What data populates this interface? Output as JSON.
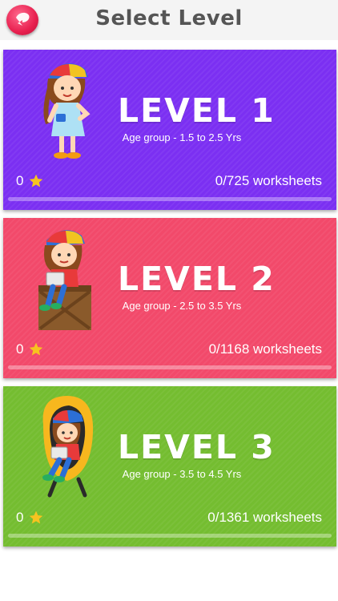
{
  "header": {
    "title": "Select Level",
    "back_icon": "back-icon",
    "back_color": "#e8204f"
  },
  "levels": [
    {
      "title": "LEVEL 1",
      "age_group": "Age group - 1.5 to 2.5 Yrs",
      "stars": "0",
      "worksheets": "0/725 worksheets",
      "progress": 0,
      "color": "#7b2ff2",
      "illustration": "girl-standing-illustration"
    },
    {
      "title": "LEVEL 2",
      "age_group": "Age group - 2.5 to 3.5 Yrs",
      "stars": "0",
      "worksheets": "0/1168 worksheets",
      "progress": 0,
      "color": "#f2496a",
      "illustration": "girl-on-crate-illustration"
    },
    {
      "title": "LEVEL 3",
      "age_group": "Age group - 3.5 to 4.5 Yrs",
      "stars": "0",
      "worksheets": "0/1361 worksheets",
      "progress": 0,
      "color": "#74bd30",
      "illustration": "girl-in-chair-illustration"
    }
  ],
  "star_icon": "star-icon",
  "star_color": "#f7c320"
}
